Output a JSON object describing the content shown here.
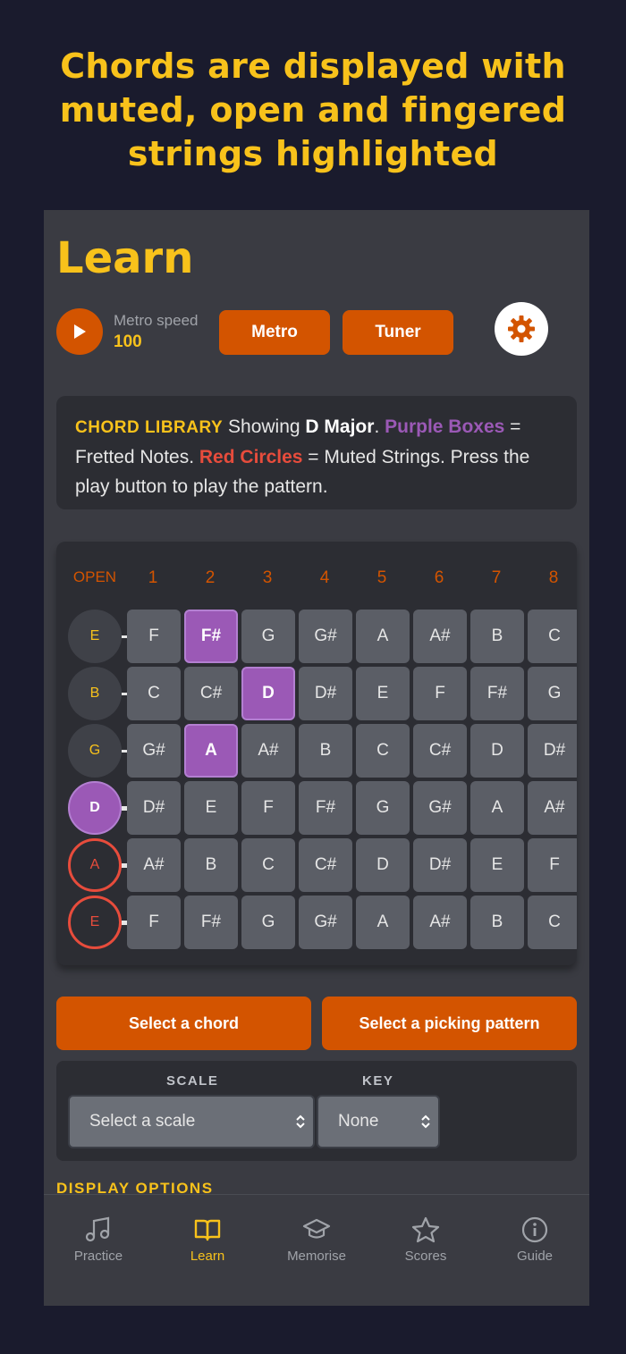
{
  "headline": {
    "line1": "Chords are displayed with",
    "line2": "muted, open and fingered",
    "line3": "strings highlighted"
  },
  "page": {
    "title": "Learn"
  },
  "controls": {
    "play_icon": "play-icon",
    "metro_label": "Metro speed",
    "metro_value": "100",
    "metro_button": "Metro",
    "tuner_button": "Tuner",
    "settings_icon": "gear-icon"
  },
  "info": {
    "lib_label": "CHORD LIBRARY",
    "showing": "Showing ",
    "chord": "D Major",
    "period": ".",
    "purple_label": "Purple Boxes",
    "purple_desc": " = Fretted Notes. ",
    "red_label": "Red Circles",
    "red_desc": " = Muted Strings. Press the play button to play the pattern."
  },
  "fretboard": {
    "fret_labels": [
      "OPEN",
      "1",
      "2",
      "3",
      "4",
      "5",
      "6",
      "7",
      "8"
    ],
    "strings": [
      {
        "name": "E",
        "state": "open",
        "notes": [
          "F",
          "F#",
          "G",
          "G#",
          "A",
          "A#",
          "B",
          "C"
        ],
        "fretted": 2
      },
      {
        "name": "B",
        "state": "open",
        "notes": [
          "C",
          "C#",
          "D",
          "D#",
          "E",
          "F",
          "F#",
          "G"
        ],
        "fretted": 3
      },
      {
        "name": "G",
        "state": "open",
        "notes": [
          "G#",
          "A",
          "A#",
          "B",
          "C",
          "C#",
          "D",
          "D#"
        ],
        "fretted": 2
      },
      {
        "name": "D",
        "state": "fingered",
        "notes": [
          "D#",
          "E",
          "F",
          "F#",
          "G",
          "G#",
          "A",
          "A#"
        ],
        "fretted": 0
      },
      {
        "name": "A",
        "state": "muted",
        "notes": [
          "A#",
          "B",
          "C",
          "C#",
          "D",
          "D#",
          "E",
          "F"
        ],
        "fretted": 0
      },
      {
        "name": "E",
        "state": "muted",
        "notes": [
          "F",
          "F#",
          "G",
          "G#",
          "A",
          "A#",
          "B",
          "C"
        ],
        "fretted": 0
      }
    ]
  },
  "actions": {
    "select_chord": "Select a chord",
    "select_pattern": "Select a picking pattern"
  },
  "scale": {
    "scale_label": "SCALE",
    "key_label": "KEY",
    "scale_value": "Select a scale",
    "key_value": "None"
  },
  "display_options": "DISPLAY OPTIONS",
  "tabs": [
    {
      "label": "Practice",
      "icon": "music-note-icon"
    },
    {
      "label": "Learn",
      "icon": "book-icon"
    },
    {
      "label": "Memorise",
      "icon": "graduation-cap-icon"
    },
    {
      "label": "Scores",
      "icon": "star-icon"
    },
    {
      "label": "Guide",
      "icon": "info-icon"
    }
  ],
  "colors": {
    "accent_yellow": "#f8c21b",
    "accent_orange": "#d35400",
    "fretted_purple": "#9b59b6",
    "muted_red": "#e74c3c"
  }
}
